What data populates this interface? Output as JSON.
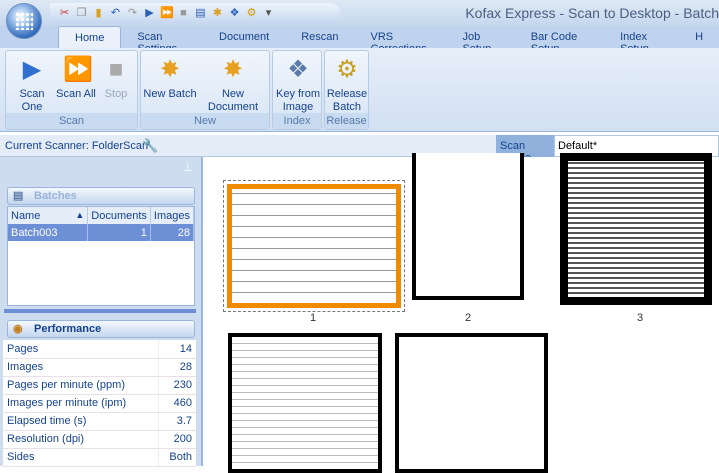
{
  "window": {
    "title": "Kofax Express - Scan to Desktop - Batch"
  },
  "quick_access": [
    "cut-icon",
    "copy-icon",
    "paste-icon",
    "undo-icon",
    "redo-icon",
    "scan-one-icon",
    "scan-all-icon",
    "stop-icon",
    "new-batch-icon",
    "new-document-icon",
    "key-from-image-icon",
    "release-icon",
    "customize-icon"
  ],
  "tabs": [
    "Home",
    "Scan Settings",
    "Document",
    "Rescan",
    "VRS Corrections",
    "Job Setup",
    "Bar Code Setup",
    "Index Setup",
    "H"
  ],
  "ribbon": {
    "scan": {
      "label": "Scan",
      "scan_one": "Scan One",
      "scan_all": "Scan All",
      "stop": "Stop"
    },
    "new": {
      "label": "New",
      "new_batch": "New Batch",
      "new_document": "New Document"
    },
    "index": {
      "label": "Index",
      "key_from_image_1": "Key from",
      "key_from_image_2": "Image"
    },
    "release": {
      "label": "Release",
      "release_1": "Release",
      "release_2": "Batch"
    }
  },
  "scanner": {
    "label": "Current Scanner: FolderScan"
  },
  "scan_profile": {
    "label": "Scan Profile",
    "value": "Default*"
  },
  "batches": {
    "title": "Batches",
    "columns": [
      "Name",
      "Documents",
      "Images"
    ],
    "rows": [
      {
        "name": "Batch003",
        "documents": "1",
        "images": "28"
      }
    ]
  },
  "performance": {
    "title": "Performance",
    "rows": [
      {
        "label": "Pages",
        "value": "14"
      },
      {
        "label": "Images",
        "value": "28"
      },
      {
        "label": "Pages per minute (ppm)",
        "value": "230"
      },
      {
        "label": "Images per minute (ipm)",
        "value": "460"
      },
      {
        "label": "Elapsed time (s)",
        "value": "3.7"
      },
      {
        "label": "Resolution (dpi)",
        "value": "200"
      },
      {
        "label": "Sides",
        "value": "Both"
      }
    ]
  },
  "thumbnails": [
    {
      "label": "1",
      "selected": true
    },
    {
      "label": "2"
    },
    {
      "label": "3"
    },
    {
      "label": ""
    },
    {
      "label": ""
    }
  ],
  "colors": {
    "selection": "#f08a00",
    "ribbon": "#d2e0f2"
  }
}
